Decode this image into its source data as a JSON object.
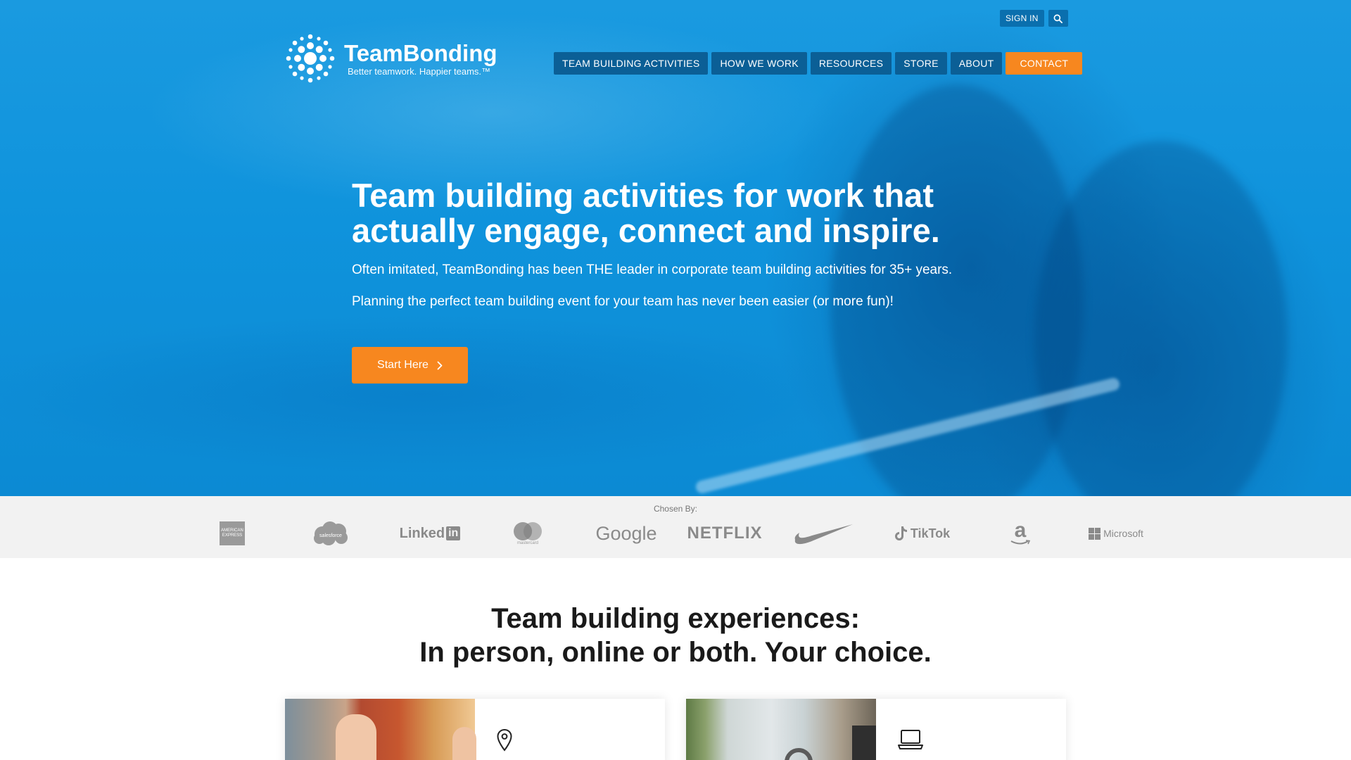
{
  "brand": {
    "name": "TeamBonding",
    "tagline": "Better teamwork. Happier teams.™",
    "colors": {
      "primary_blue": "#0f93dc",
      "nav_blue": "#0b5f96",
      "accent_orange": "#f7871f"
    }
  },
  "utility": {
    "sign_in": "SIGN IN",
    "search_icon": "search-icon"
  },
  "nav": {
    "items": [
      {
        "label": "TEAM BUILDING ACTIVITIES"
      },
      {
        "label": "HOW WE WORK"
      },
      {
        "label": "RESOURCES"
      },
      {
        "label": "STORE"
      },
      {
        "label": "ABOUT"
      }
    ],
    "contact": "CONTACT"
  },
  "hero": {
    "title": "Team building activities for work that actually engage, connect and inspire.",
    "paragraph_1": "Often imitated, TeamBonding has been THE leader in corporate team building activities for 35+ years.",
    "paragraph_2": "Planning the perfect team building event for your team has never been easier (or more fun)!",
    "cta_label": "Start Here",
    "cta_icon": "chevron-right-icon"
  },
  "clients": {
    "label": "Chosen By:",
    "logos": [
      "American Express",
      "salesforce",
      "LinkedIn",
      "mastercard",
      "Google",
      "NETFLIX",
      "Nike",
      "TikTok",
      "amazon",
      "Microsoft"
    ],
    "text": {
      "amex": "AMERICAN EXPRESS",
      "salesforce": "salesforce",
      "linkedin_word": "Linked",
      "linkedin_in": "in",
      "mastercard": "mastercard",
      "google": "Google",
      "netflix": "NETFLIX",
      "tiktok": "TikTok",
      "amazon": "a",
      "microsoft": "Microsoft"
    }
  },
  "experiences": {
    "title_line_1": "Team building experiences:",
    "title_line_2": "In person, online or both. Your choice.",
    "cards": [
      {
        "icon": "map-pin-icon"
      },
      {
        "icon": "laptop-icon"
      }
    ]
  }
}
